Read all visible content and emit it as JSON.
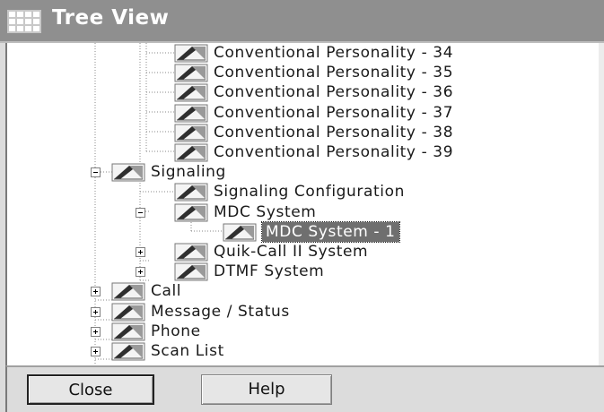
{
  "window": {
    "title": "Tree View",
    "title_icon": "grid-window-icon"
  },
  "tree": {
    "nodes": [
      {
        "label": "Conventional Personality - 34",
        "level": 3,
        "expander": null
      },
      {
        "label": "Conventional Personality - 35",
        "level": 3,
        "expander": null
      },
      {
        "label": "Conventional Personality - 36",
        "level": 3,
        "expander": null
      },
      {
        "label": "Conventional Personality - 37",
        "level": 3,
        "expander": null
      },
      {
        "label": "Conventional Personality - 38",
        "level": 3,
        "expander": null
      },
      {
        "label": "Conventional Personality - 39",
        "level": 3,
        "expander": null
      },
      {
        "label": "Signaling",
        "level": 2,
        "expander": "minus"
      },
      {
        "label": "Signaling Configuration",
        "level": 3,
        "expander": null
      },
      {
        "label": "MDC System",
        "level": 3,
        "expander": "minus"
      },
      {
        "label": "MDC System - 1",
        "level": 4,
        "expander": null,
        "selected": true
      },
      {
        "label": "Quik-Call II System",
        "level": 3,
        "expander": "plus"
      },
      {
        "label": "DTMF System",
        "level": 3,
        "expander": "plus"
      },
      {
        "label": "Call",
        "level": 2,
        "expander": "plus"
      },
      {
        "label": "Message / Status",
        "level": 2,
        "expander": "plus"
      },
      {
        "label": "Phone",
        "level": 2,
        "expander": "plus"
      },
      {
        "label": "Scan List",
        "level": 2,
        "expander": "plus"
      }
    ],
    "node_icon": "folder-ramp-icon"
  },
  "buttons": {
    "close_label": "Close",
    "help_label": "Help"
  },
  "colors": {
    "titlebar": "#8f8f8f",
    "selection": "#6f6f6f"
  }
}
